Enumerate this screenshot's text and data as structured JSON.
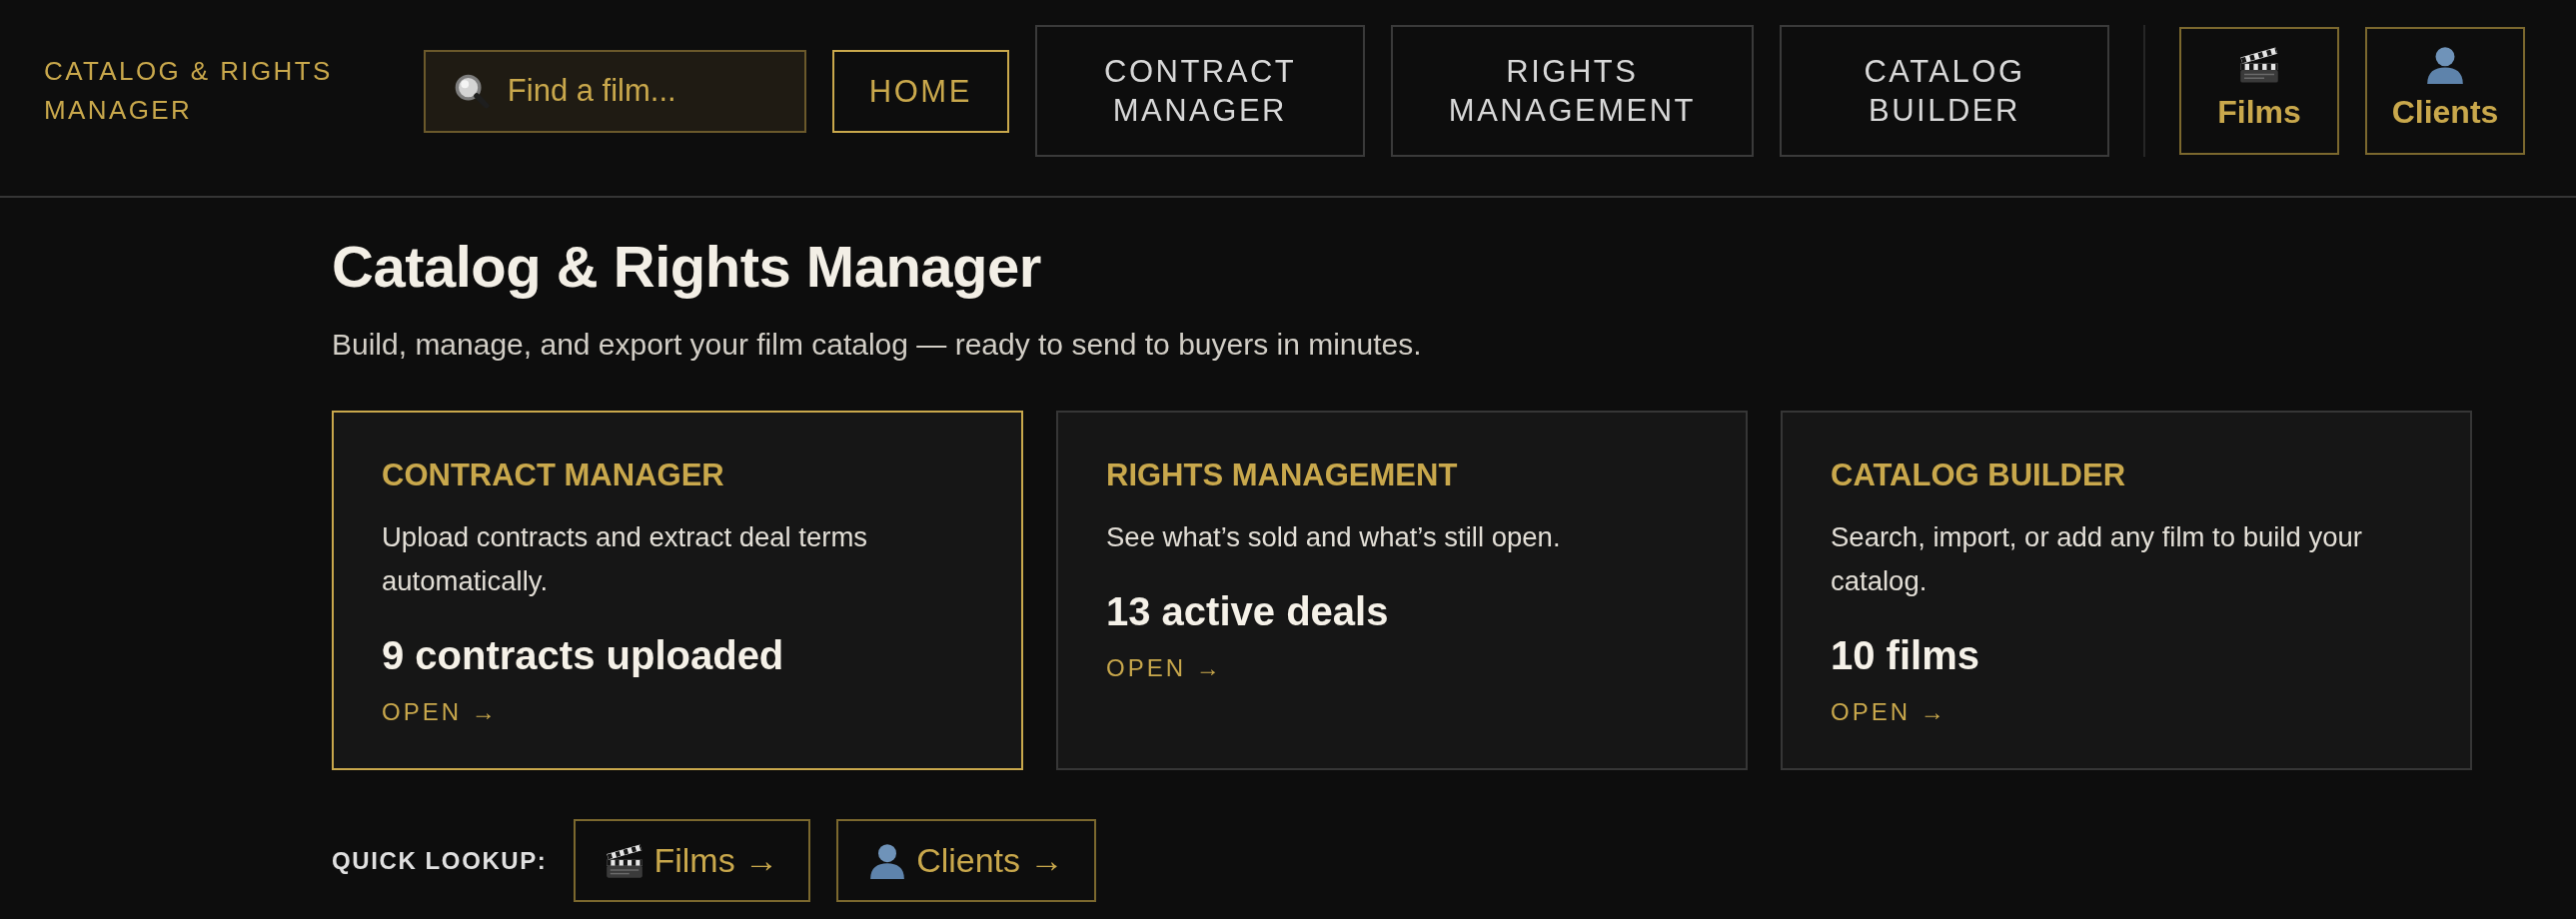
{
  "header": {
    "logo": "CATALOG & RIGHTS MANAGER",
    "search": {
      "placeholder": "Find a film..."
    },
    "nav": [
      {
        "label": "HOME",
        "kind": "home",
        "selected": true
      },
      {
        "label": "CONTRACT MANAGER",
        "kind": "module",
        "selected": false
      },
      {
        "label": "RIGHTS MANAGEMENT",
        "kind": "module",
        "selected": false
      },
      {
        "label": "CATALOG BUILDER",
        "kind": "module",
        "selected": false
      }
    ],
    "shortcuts": [
      {
        "label": "Films",
        "kind": "clapperboard"
      },
      {
        "label": "Clients",
        "kind": "person"
      }
    ]
  },
  "page": {
    "title": "Catalog & Rights Manager",
    "subtitle": "Build, manage, and export your film catalog — ready to send to buyers in minutes."
  },
  "cards": [
    {
      "title": "CONTRACT MANAGER",
      "description": "Upload contracts and extract deal terms automatically.",
      "stat": "9 contracts uploaded",
      "action": "OPEN →",
      "selected": true
    },
    {
      "title": "RIGHTS MANAGEMENT",
      "description": "See what’s sold and what’s still open.",
      "stat": "13 active deals",
      "action": "OPEN →",
      "selected": false
    },
    {
      "title": "CATALOG BUILDER",
      "description": "Search, import, or add any film to build your catalog.",
      "stat": "10 films",
      "action": "OPEN →",
      "selected": false
    }
  ],
  "quick_lookup": {
    "label": "QUICK LOOKUP:",
    "links": [
      {
        "label": "Films →",
        "kind": "clapperboard"
      },
      {
        "label": "Clients →",
        "kind": "person"
      }
    ]
  }
}
